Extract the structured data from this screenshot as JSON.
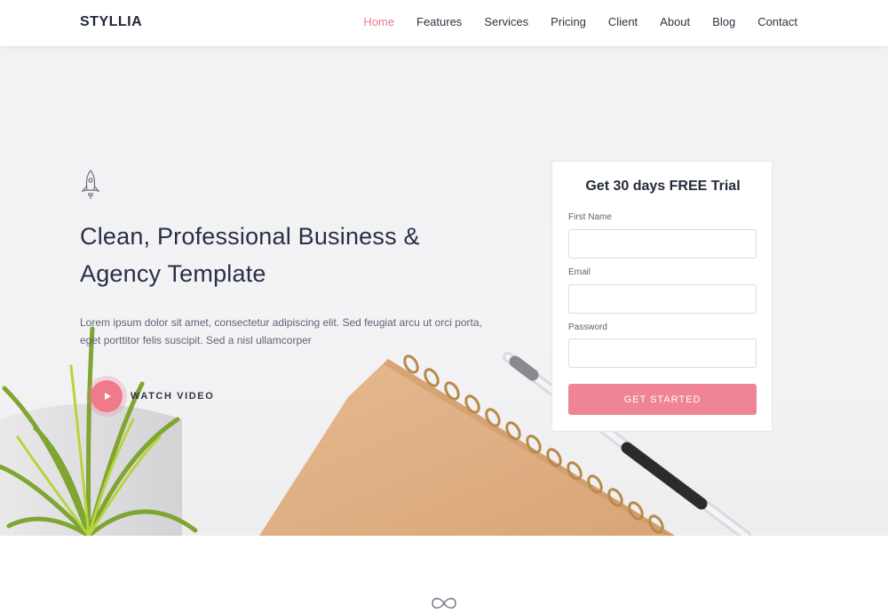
{
  "brand": "STYLLIA",
  "nav": {
    "items": [
      {
        "label": "Home",
        "active": true
      },
      {
        "label": "Features",
        "active": false
      },
      {
        "label": "Services",
        "active": false
      },
      {
        "label": "Pricing",
        "active": false
      },
      {
        "label": "Client",
        "active": false
      },
      {
        "label": "About",
        "active": false
      },
      {
        "label": "Blog",
        "active": false
      },
      {
        "label": "Contact",
        "active": false
      }
    ]
  },
  "hero": {
    "icon": "rocket-icon",
    "title_line1": "Clean, Professional Business &",
    "title_line2": "Agency Template",
    "text_line1": "Lorem ipsum dolor sit amet, consectetur adipiscing elit. Sed feugiat arcu ut orci porta,",
    "text_line2": "eget porttitor felis suscipit. Sed a nisl ullamcorper",
    "watch_label": "WATCH VIDEO"
  },
  "form": {
    "title": "Get 30 days FREE Trial",
    "first_name_label": "First Name",
    "first_name_value": "",
    "email_label": "Email",
    "email_value": "",
    "password_label": "Password",
    "password_value": "",
    "submit_label": "GET STARTED"
  },
  "colors": {
    "accent": "#ee7a8a",
    "button": "#ef8494",
    "heading": "#283046"
  },
  "section_icon": "infinity-icon"
}
